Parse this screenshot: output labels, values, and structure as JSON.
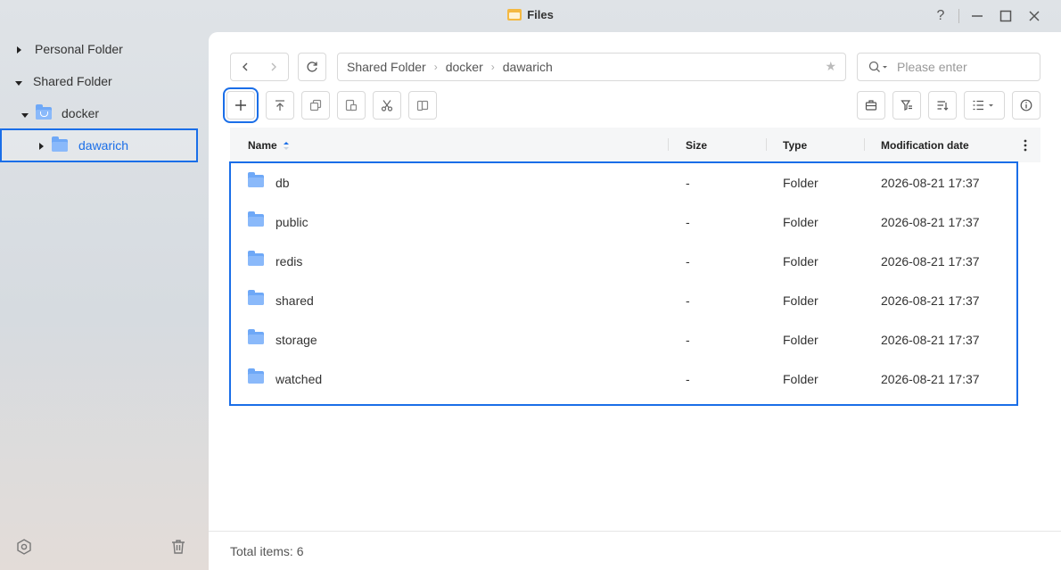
{
  "window": {
    "title": "Files",
    "controls": {
      "help": "?",
      "minimize": "—",
      "maximize": "☐",
      "close": "✕"
    }
  },
  "sidebar": {
    "items": [
      {
        "label": "Personal Folder",
        "expanded": false
      },
      {
        "label": "Shared Folder",
        "expanded": true
      },
      {
        "label": "docker",
        "expanded": true
      },
      {
        "label": "dawarich",
        "expanded": false,
        "selected": true
      }
    ]
  },
  "toolbar": {
    "breadcrumb": [
      "Shared Folder",
      "docker",
      "dawarich"
    ],
    "search_placeholder": "Please enter"
  },
  "table": {
    "columns": {
      "name": "Name",
      "size": "Size",
      "type": "Type",
      "date": "Modification date"
    },
    "rows": [
      {
        "name": "db",
        "size": "-",
        "type": "Folder",
        "date": "2026-08-21 17:37"
      },
      {
        "name": "public",
        "size": "-",
        "type": "Folder",
        "date": "2026-08-21 17:37"
      },
      {
        "name": "redis",
        "size": "-",
        "type": "Folder",
        "date": "2026-08-21 17:37"
      },
      {
        "name": "shared",
        "size": "-",
        "type": "Folder",
        "date": "2026-08-21 17:37"
      },
      {
        "name": "storage",
        "size": "-",
        "type": "Folder",
        "date": "2026-08-21 17:37"
      },
      {
        "name": "watched",
        "size": "-",
        "type": "Folder",
        "date": "2026-08-21 17:37"
      }
    ]
  },
  "footer": {
    "total_items": "Total items: 6"
  },
  "colors": {
    "accent": "#1a6ee8",
    "folder": "#8ab9fa"
  }
}
